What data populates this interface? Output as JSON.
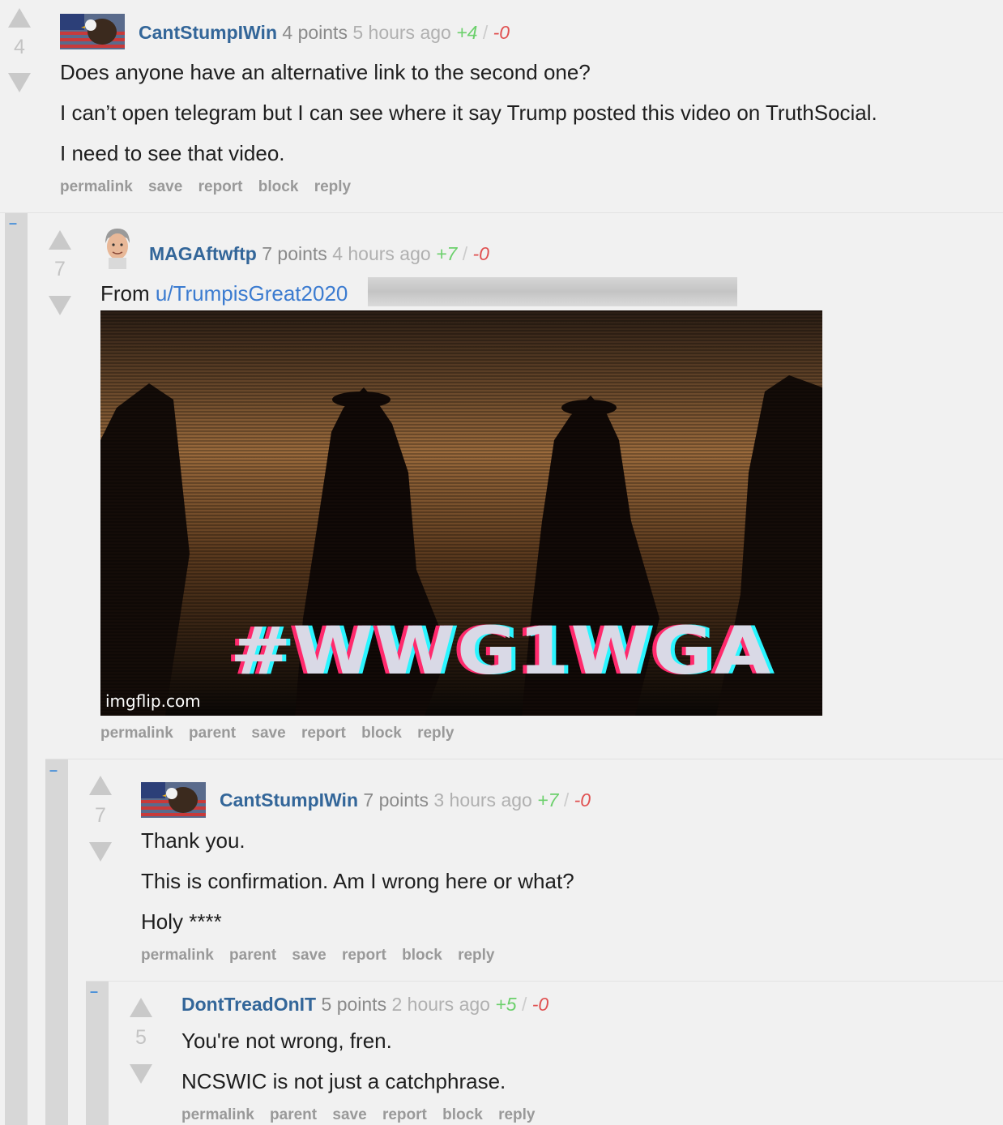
{
  "comments": [
    {
      "score": "4",
      "author": "CantStumpIWin",
      "points": "4 points",
      "time": "5 hours ago",
      "up": "+4",
      "slash": "/",
      "down": "-0",
      "avatar": "eagle-flag-avatar",
      "paragraphs": [
        "Does anyone have an alternative link to the second one?",
        "I can’t open telegram but I can see where it say Trump posted this video on TruthSocial.",
        "I need to see that video."
      ],
      "actions": [
        "permalink",
        "save",
        "report",
        "block",
        "reply"
      ]
    },
    {
      "collapse": "–",
      "score": "7",
      "author": "MAGAftwftp",
      "points": "7 points",
      "time": "4 hours ago",
      "up": "+7",
      "slash": "/",
      "down": "-0",
      "avatar": "man-portrait-avatar",
      "from_label": "From ",
      "from_link": "u/TrumpisGreat2020",
      "gif": {
        "overlay_text": "#WWG1WGA",
        "watermark": "imgflip.com"
      },
      "actions": [
        "permalink",
        "parent",
        "save",
        "report",
        "block",
        "reply"
      ]
    },
    {
      "collapse": "–",
      "score": "7",
      "author": "CantStumpIWin",
      "points": "7 points",
      "time": "3 hours ago",
      "up": "+7",
      "slash": "/",
      "down": "-0",
      "avatar": "eagle-flag-avatar",
      "paragraphs": [
        "Thank you.",
        "This is confirmation. Am I wrong here or what?",
        "Holy ****"
      ],
      "actions": [
        "permalink",
        "parent",
        "save",
        "report",
        "block",
        "reply"
      ]
    },
    {
      "collapse": "–",
      "score": "5",
      "author": "DontTreadOnIT",
      "points": "5 points",
      "time": "2 hours ago",
      "up": "+5",
      "slash": "/",
      "down": "-0",
      "paragraphs": [
        "You're not wrong, fren.",
        "NCSWIC is not just a catchphrase."
      ],
      "actions": [
        "permalink",
        "parent",
        "save",
        "report",
        "block",
        "reply"
      ]
    }
  ],
  "colors": {
    "author": "#336699",
    "upvotes": "#6cd06c",
    "downvotes": "#e05050",
    "rail": "#d7d7d7",
    "background": "#f1f1f1"
  }
}
